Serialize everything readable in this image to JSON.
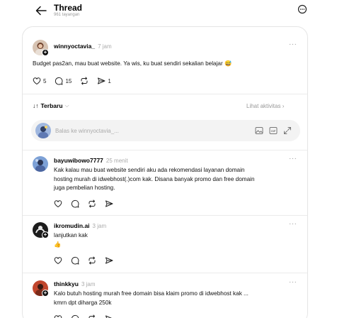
{
  "header": {
    "title": "Thread",
    "views": "961 tayangan"
  },
  "post": {
    "username": "winnyoctavia_",
    "time": "7 jam",
    "text": "Budget pas2an, mau buat website. Ya wis, ku buat sendiri sekalian belajar 😅",
    "likes": "5",
    "comments": "15",
    "shares": "1"
  },
  "sort": {
    "label": "Terbaru",
    "activity_link": "Lihat aktivitas"
  },
  "reply": {
    "placeholder": "Balas ke winnyoctavia_..."
  },
  "comments": [
    {
      "username": "bayuwibowo7777",
      "time": "25 menit",
      "lines": [
        "Kak kalau mau buat website sendiri aku ada rekomendasi layanan domain",
        "hosting murah di idwebhost(.)com kak. Disana banyak promo dan free domain",
        "juga pembelian hosting."
      ]
    },
    {
      "username": "ikromudin.ai",
      "time": "3 jam",
      "lines": [
        "lanjutkan kak",
        "👍"
      ]
    },
    {
      "username": "thinkkyu",
      "time": "3 jam",
      "lines": [
        "Kalo butuh hosting murah free domain bisa klaim promo di idwebhost kak ...",
        "kmrn dpt diharga 250k"
      ]
    }
  ],
  "colors": {
    "divider": "#ebebeb",
    "muted": "#999999",
    "reply_bg": "#f3f3f3"
  }
}
